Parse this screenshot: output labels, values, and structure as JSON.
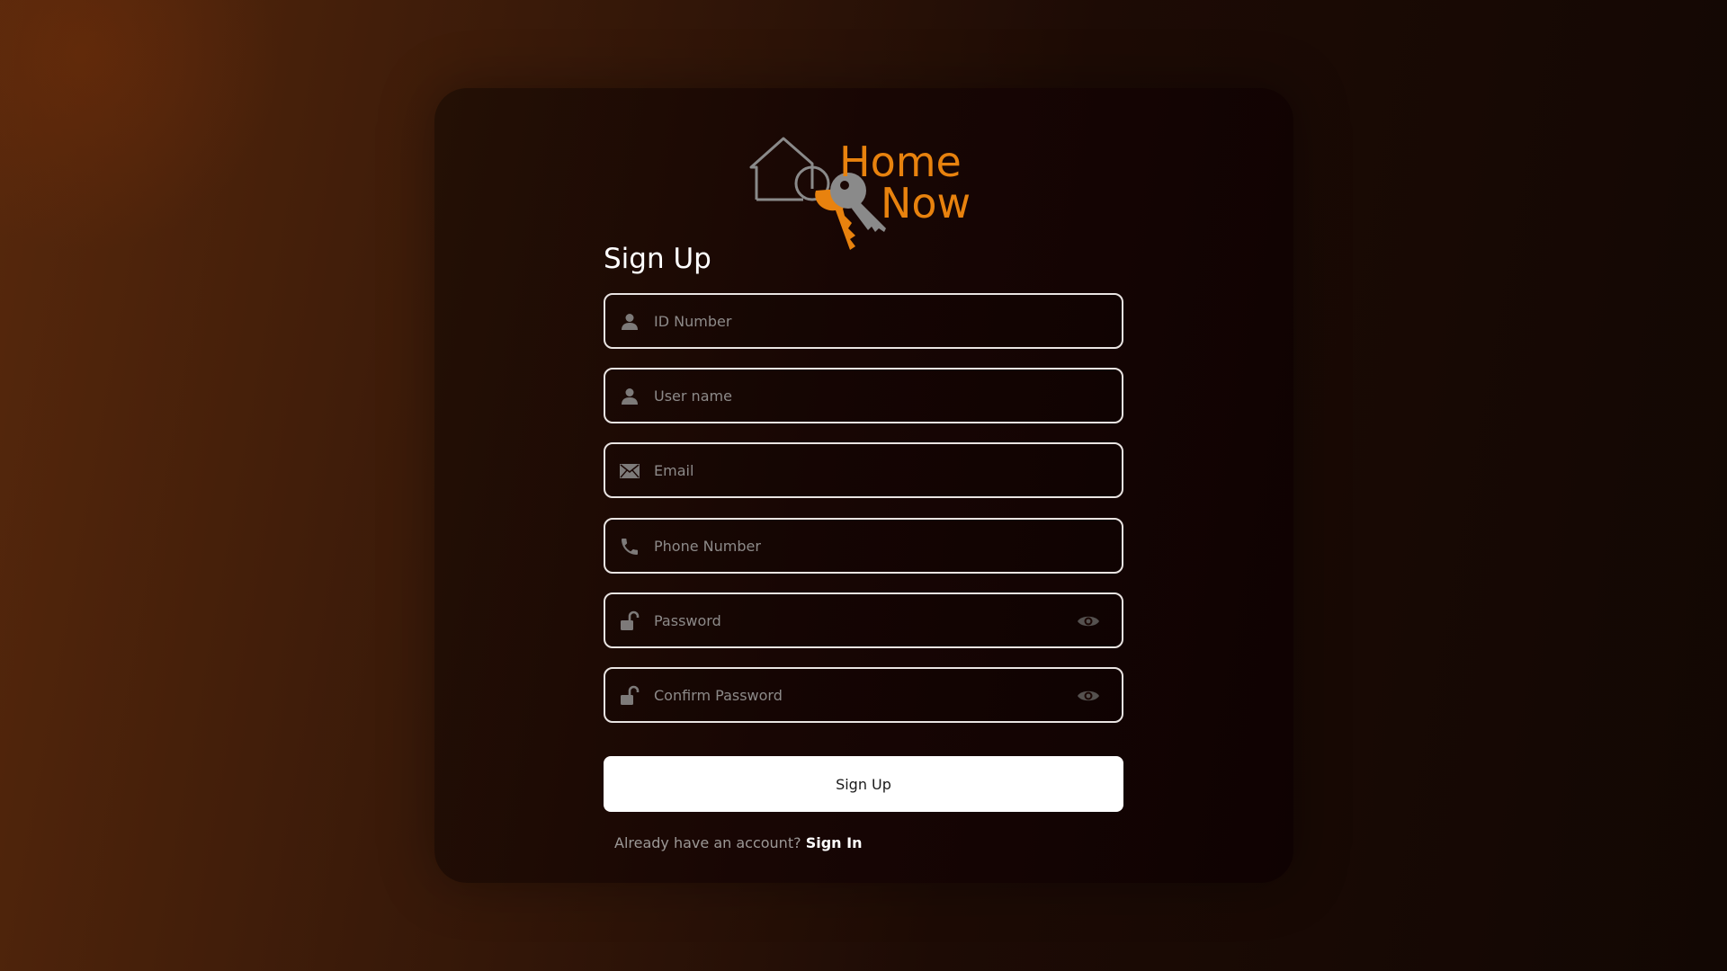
{
  "brand": {
    "line1": "Home",
    "line2": "Now",
    "accent_color": "#e8820e",
    "icon_color": "#8a8a8a"
  },
  "form": {
    "title": "Sign Up",
    "fields": [
      {
        "icon": "user-icon",
        "placeholder": "ID Number",
        "value": ""
      },
      {
        "icon": "user-icon",
        "placeholder": "User name",
        "value": ""
      },
      {
        "icon": "envelope-icon",
        "placeholder": "Email",
        "value": ""
      },
      {
        "icon": "phone-icon",
        "placeholder": "Phone Number",
        "value": ""
      },
      {
        "icon": "unlock-icon",
        "placeholder": "Password",
        "value": "",
        "toggle_icon": "eye-icon"
      },
      {
        "icon": "unlock-icon",
        "placeholder": "Confirm Password",
        "value": "",
        "toggle_icon": "eye-icon"
      }
    ],
    "submit_label": "Sign Up"
  },
  "footer": {
    "prompt": "Already have an account?",
    "link_label": "Sign In"
  }
}
